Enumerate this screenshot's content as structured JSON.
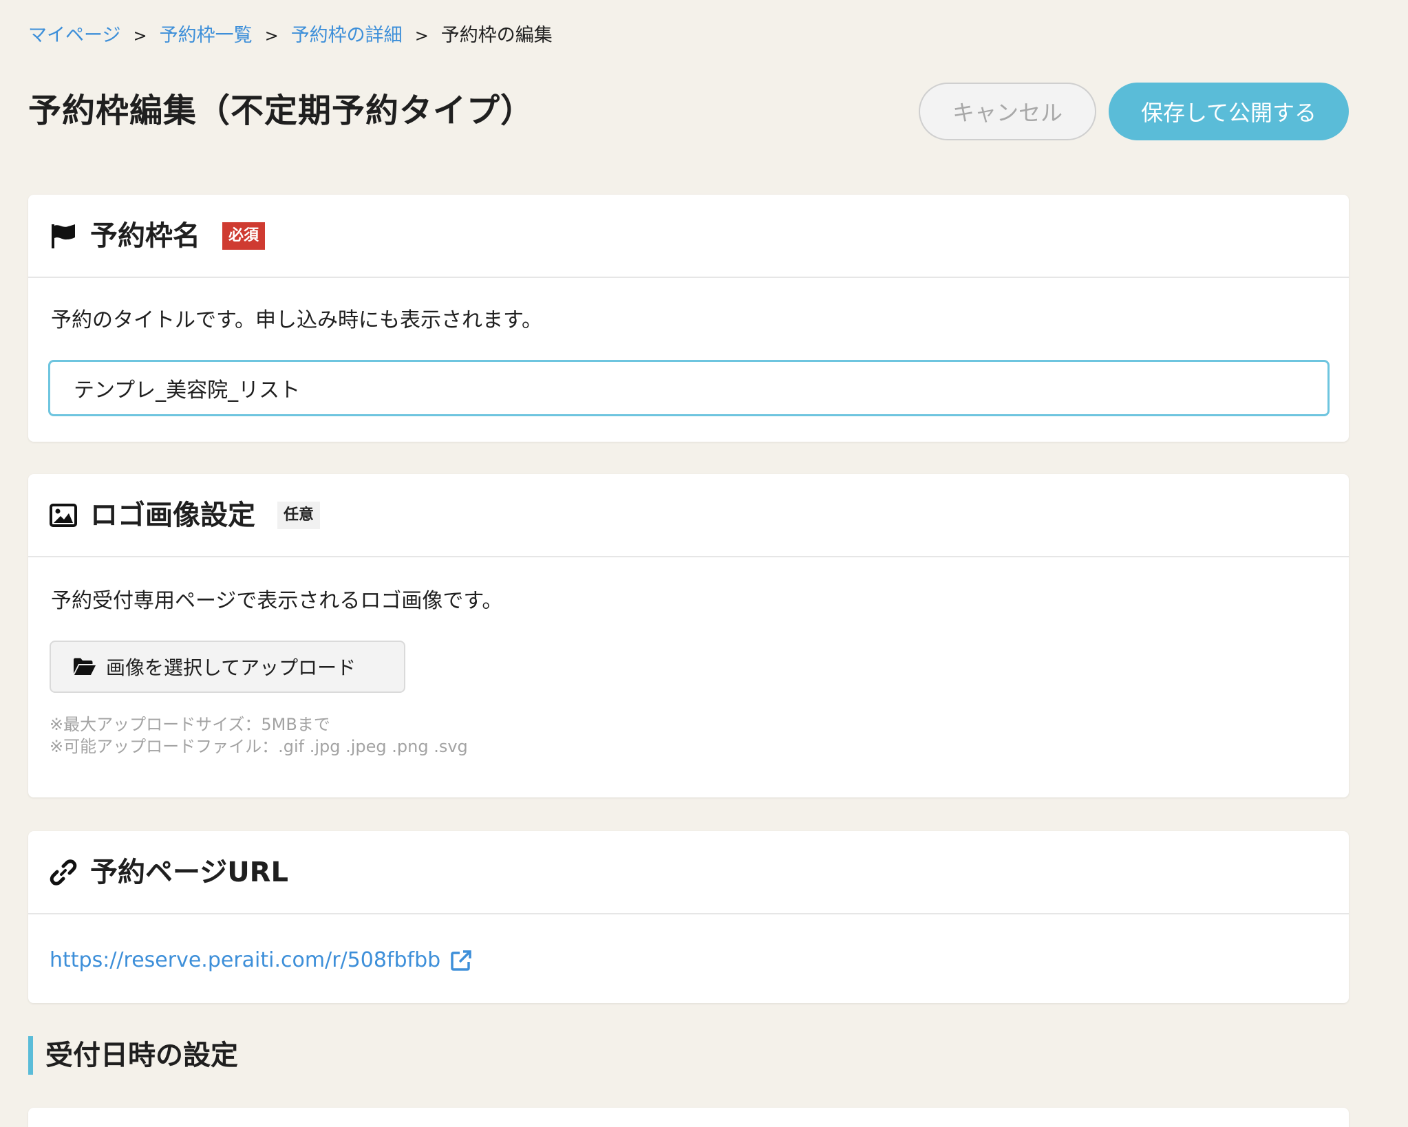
{
  "breadcrumb": {
    "items": [
      "マイページ",
      "予約枠一覧",
      "予約枠の詳細"
    ],
    "separator": ">",
    "current": "予約枠の編集"
  },
  "header": {
    "title": "予約枠編集（不定期予約タイプ）",
    "cancel_label": "キャンセル",
    "publish_label": "保存して公開する"
  },
  "name_section": {
    "icon": "flag-icon",
    "title": "予約枠名",
    "badge": "必須",
    "description": "予約のタイトルです。申し込み時にも表示されます。",
    "input_value": "テンプレ_美容院_リスト"
  },
  "logo_section": {
    "icon": "image-icon",
    "title": "ロゴ画像設定",
    "badge": "任意",
    "description": "予約受付専用ページで表示されるロゴ画像です。",
    "upload_label": "画像を選択してアップロード",
    "upload_icon": "folder-open-icon",
    "note_max_size": "※最大アップロードサイズ：5MBまで",
    "note_file_types": "※可能アップロードファイル：.gif .jpg .jpeg .png .svg"
  },
  "url_section": {
    "icon": "link-icon",
    "title": "予約ページURL",
    "url": "https://reserve.peraiti.com/r/508fbfbb",
    "external_icon": "external-link-icon"
  },
  "schedule_section": {
    "title": "受付日時の設定"
  },
  "colors": {
    "background": "#f4f1ea",
    "accent": "#5abcd8",
    "link": "#3d8fd9",
    "required_badge": "#cf3b31"
  }
}
